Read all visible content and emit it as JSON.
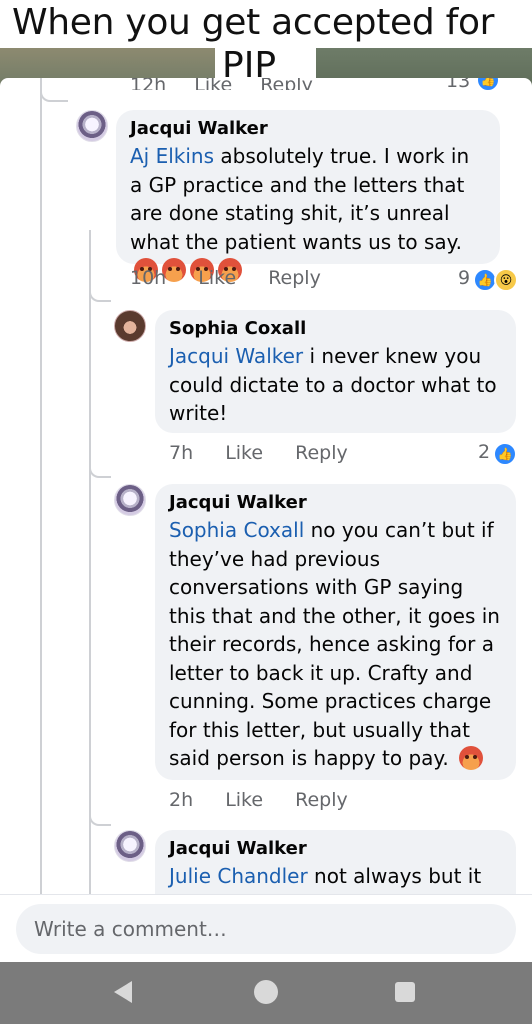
{
  "caption": {
    "line1": "When you get accepted for",
    "line2": "PIP"
  },
  "cutoff_row": {
    "time": "12h",
    "like": "Like",
    "reply": "Reply",
    "count": "13"
  },
  "comments": [
    {
      "author": "Jacqui Walker",
      "mention": "Aj Elkins",
      "text": " absolutely true. I work in a GP practice and the letters that are done stating shit, it’s unreal what the patient wants us to say.",
      "reactions_inline": [
        "angry",
        "angry",
        "angry",
        "angry"
      ],
      "time": "10h",
      "like": "Like",
      "reply": "Reply",
      "reaction_count": "9",
      "reaction_icons": [
        "like",
        "wow"
      ]
    },
    {
      "author": "Sophia Coxall",
      "mention": "Jacqui Walker",
      "text": " i never knew you could dictate to a doctor what to write!",
      "time": "7h",
      "like": "Like",
      "reply": "Reply",
      "reaction_count": "2",
      "reaction_icons": [
        "like"
      ]
    },
    {
      "author": "Jacqui Walker",
      "mention": "Sophia Coxall",
      "text": " no you can’t but if they’ve had previous conversations with GP saying this that and the other, it goes in their records, hence asking for a letter to back it up. Crafty and cunning. Some practices charge for this letter, but usually that said person is happy to pay.",
      "reactions_inline": [
        "angry"
      ],
      "time": "2h",
      "like": "Like",
      "reply": "Reply"
    },
    {
      "author": "Jacqui Walker",
      "mention": "Julie Chandler",
      "text": " not always but it"
    }
  ],
  "composer": {
    "placeholder": "Write a comment…"
  },
  "colors": {
    "mention": "#1b5fb0",
    "bubble": "#f0f2f5",
    "meta": "#65676b",
    "like": "#2d88ff"
  },
  "icons": {
    "back": "back-triangle-icon",
    "home": "home-circle-icon",
    "recents": "recents-square-icon"
  }
}
